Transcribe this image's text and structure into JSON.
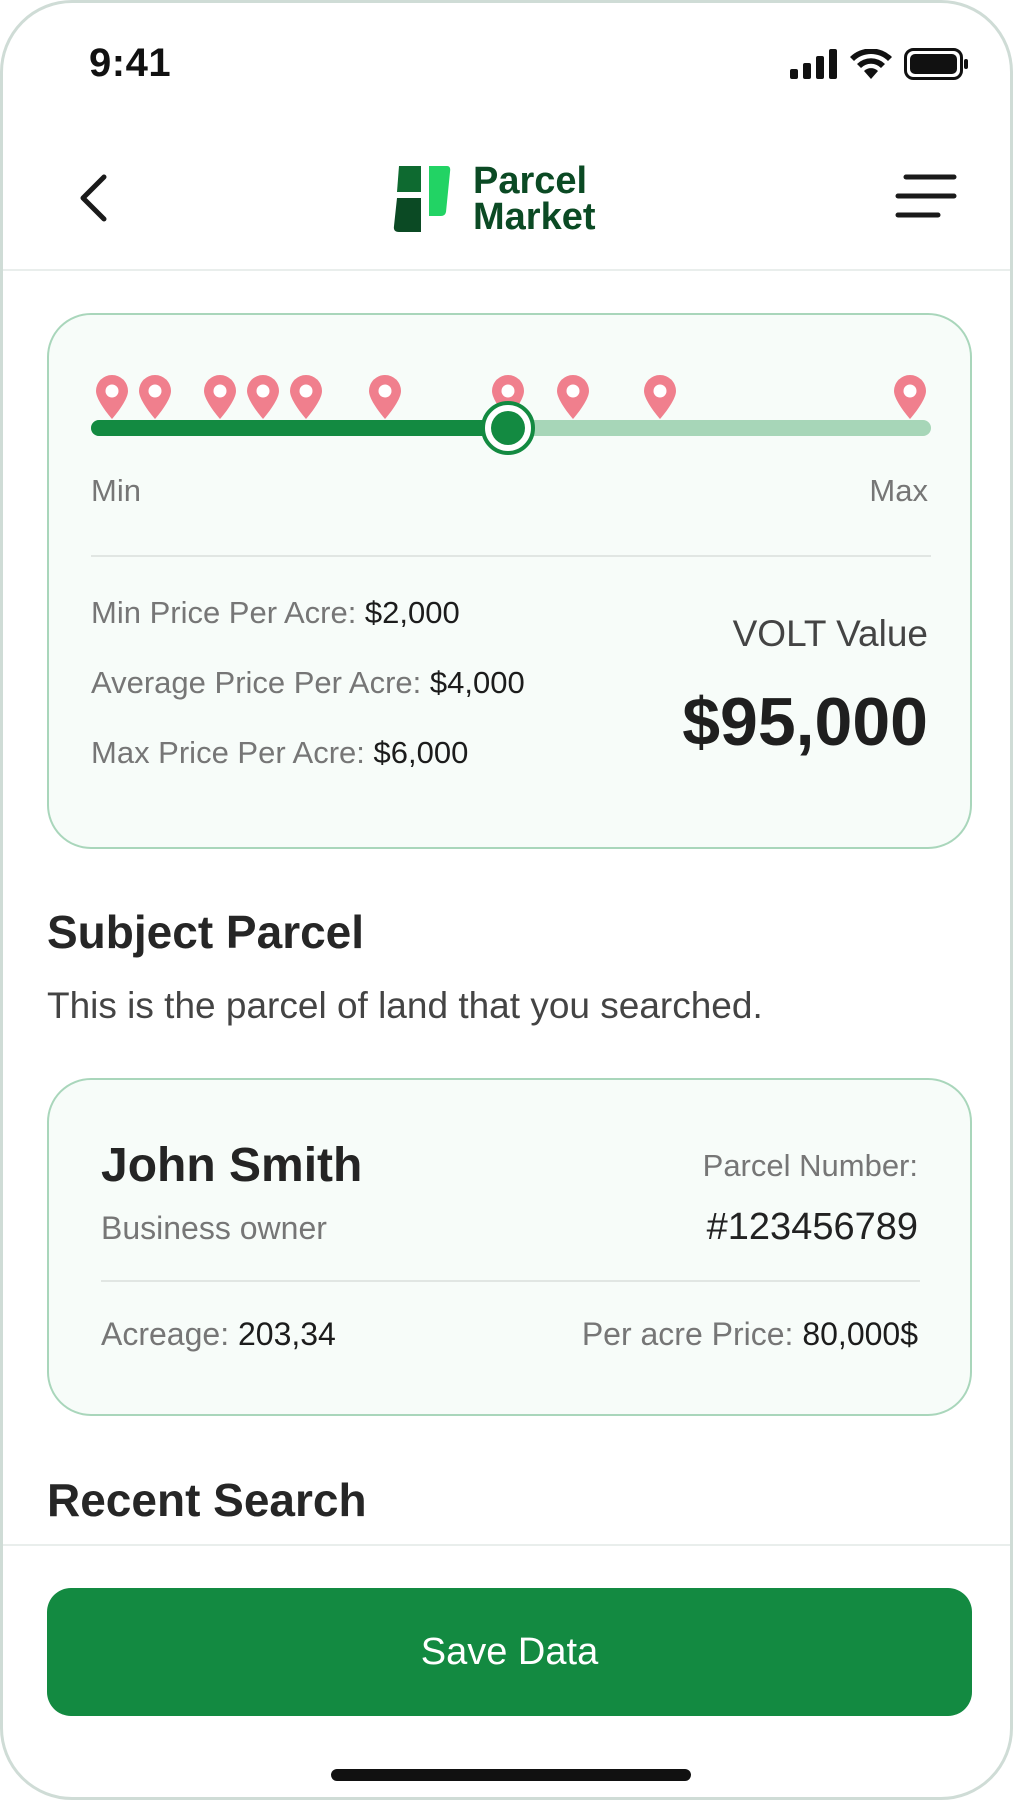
{
  "status_bar": {
    "time": "9:41"
  },
  "header": {
    "logo_line1": "Parcel",
    "logo_line2": "Market"
  },
  "price_card": {
    "slider": {
      "value_fraction": 0.497,
      "min_label": "Min",
      "max_label": "Max",
      "pin_fractions": [
        0.025,
        0.076,
        0.153,
        0.205,
        0.256,
        0.35,
        0.497,
        0.574,
        0.677,
        0.975
      ],
      "pin_color": "#f07f8d",
      "track_color": "#a7d6b8",
      "fill_color": "#138a41"
    },
    "min_price_label": "Min Price Per Acre: ",
    "min_price_value": "$2,000",
    "avg_price_label": "Average Price Per Acre: ",
    "avg_price_value": "$4,000",
    "max_price_label": "Max Price Per Acre: ",
    "max_price_value": "$6,000",
    "volt_label": "VOLT Value",
    "volt_value": "$95,000"
  },
  "subject_parcel": {
    "title": "Subject Parcel",
    "subtitle": "This is the parcel of land that you searched.",
    "owner_name": "John Smith",
    "owner_role": "Business owner",
    "parcel_number_label": "Parcel Number:",
    "parcel_number": "#123456789",
    "acreage_label": "Acreage: ",
    "acreage_value": "203,34",
    "per_acre_label": "Per acre Price: ",
    "per_acre_value": "80,000$"
  },
  "recent_search": {
    "title": "Recent Search"
  },
  "actions": {
    "save_label": "Save Data"
  },
  "colors": {
    "brand_green": "#138a41",
    "logo_dark": "#0b4a24",
    "logo_light": "#22d364"
  }
}
